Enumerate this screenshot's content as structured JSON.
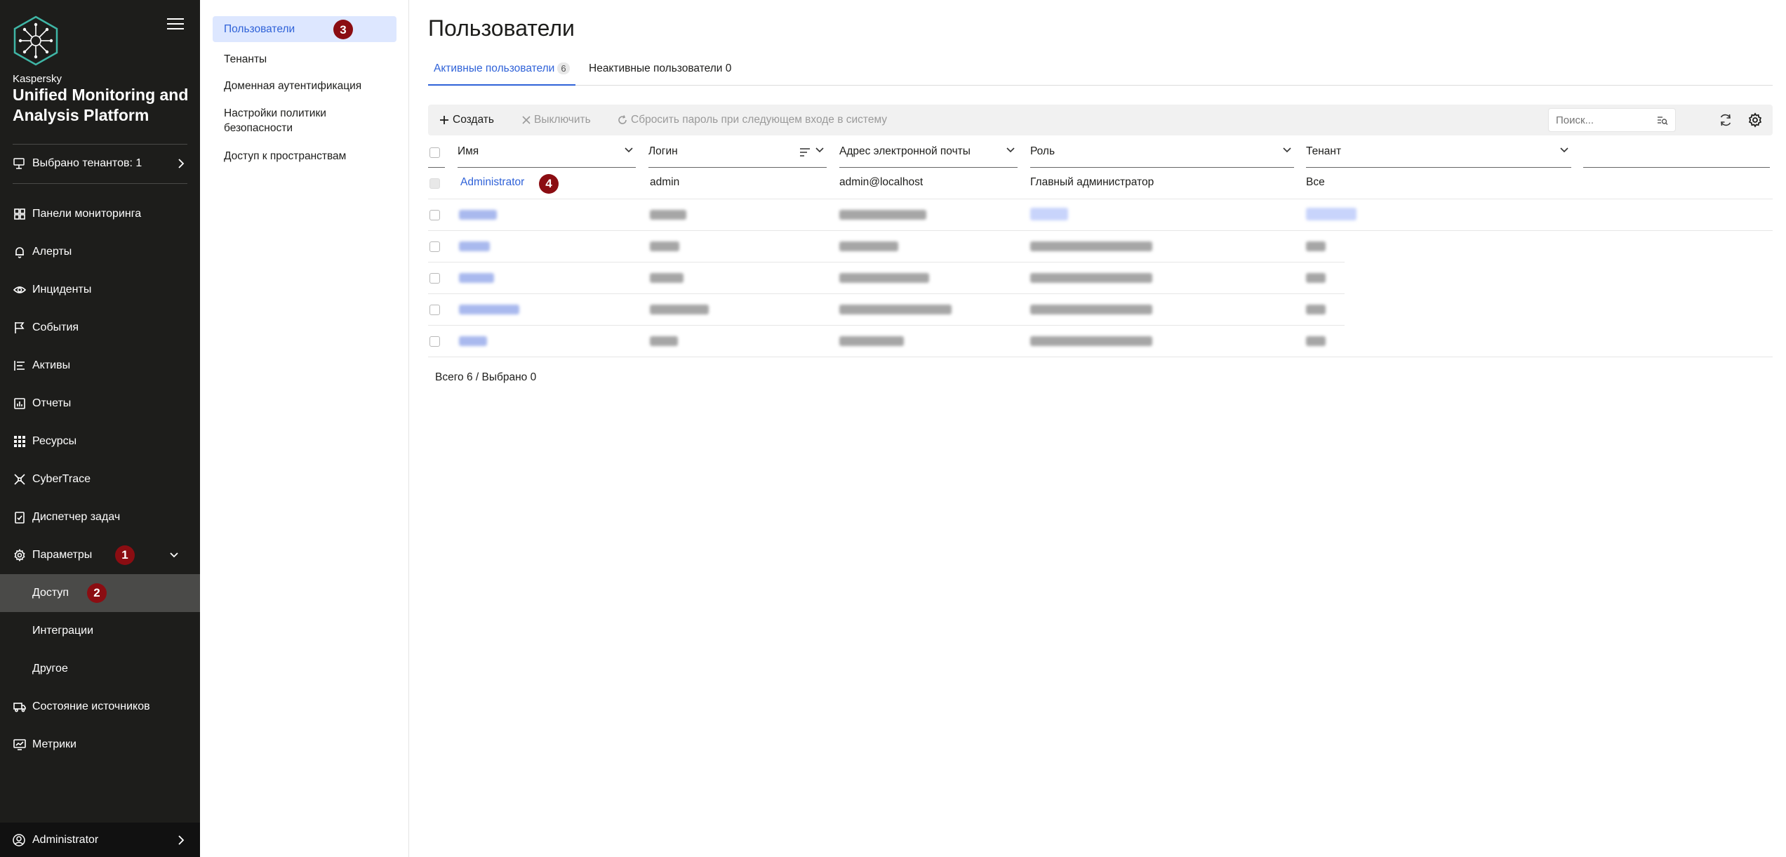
{
  "colors": {
    "nav_bg": "#1d1d1b",
    "accent": "#2f62d8",
    "badge": "#8b0d12",
    "active_sub_bg": "#dde7ff"
  },
  "brand": {
    "small": "Kaspersky",
    "big": "Unified Monitoring and Analysis Platform"
  },
  "tenant_selector": {
    "label": "Выбрано тенантов: 1"
  },
  "nav": {
    "items": [
      {
        "label": "Панели мониторинга",
        "icon": "dashboard-icon"
      },
      {
        "label": "Алерты",
        "icon": "bell-icon"
      },
      {
        "label": "Инциденты",
        "icon": "eye-icon"
      },
      {
        "label": "События",
        "icon": "flag-icon"
      },
      {
        "label": "Активы",
        "icon": "assets-icon"
      },
      {
        "label": "Отчеты",
        "icon": "report-icon"
      },
      {
        "label": "Ресурсы",
        "icon": "grid-icon"
      },
      {
        "label": "CyberTrace",
        "icon": "cybertrace-icon"
      },
      {
        "label": "Диспетчер задач",
        "icon": "task-icon"
      },
      {
        "label": "Параметры",
        "icon": "gear-icon",
        "badge": "1",
        "expanded": true
      },
      {
        "label": "Доступ",
        "sub": true,
        "active": true,
        "badge": "2"
      },
      {
        "label": "Интеграции",
        "sub": true
      },
      {
        "label": "Другое",
        "sub": true
      },
      {
        "label": "Состояние источников",
        "icon": "source-icon"
      },
      {
        "label": "Метрики",
        "icon": "metrics-icon"
      }
    ],
    "user": "Administrator"
  },
  "subnav": {
    "items": [
      {
        "label": "Пользователи",
        "active": true,
        "badge": "3"
      },
      {
        "label": "Тенанты"
      },
      {
        "label": "Доменная аутентификация"
      },
      {
        "label": "Настройки политики безопасности"
      },
      {
        "label": "Доступ к пространствам"
      }
    ]
  },
  "main": {
    "title": "Пользователи",
    "tabs": [
      {
        "label": "Активные пользователи",
        "count": "6",
        "active": true
      },
      {
        "label": "Неактивные пользователи 0"
      }
    ],
    "toolbar": {
      "create": "Создать",
      "disable": "Выключить",
      "reset": "Сбросить пароль при следующем входе в систему",
      "search_placeholder": "Поиск..."
    },
    "columns": [
      "Имя",
      "Логин",
      "Адрес электронной почты",
      "Роль",
      "Тенант"
    ],
    "rows": [
      {
        "name": "Administrator",
        "login": "admin",
        "email": "admin@localhost",
        "role": "Главный администратор",
        "tenant": "Все",
        "badge": "4"
      }
    ],
    "footer": "Всего 6 / Выбрано 0"
  }
}
